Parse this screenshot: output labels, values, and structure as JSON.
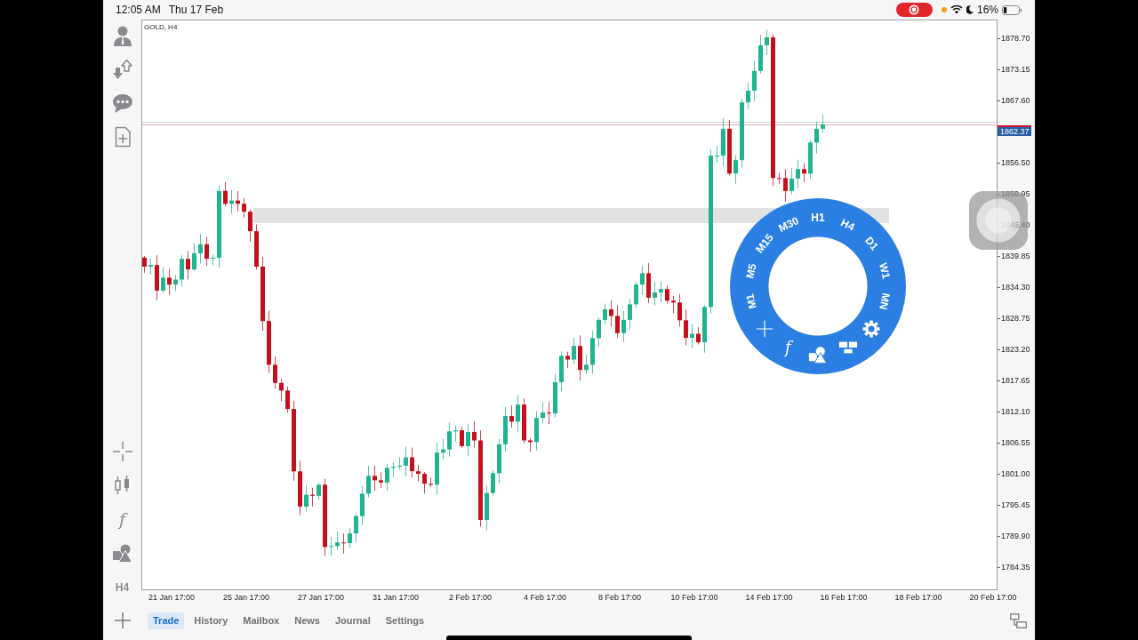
{
  "status_bar": {
    "time": "12:05 AM",
    "date": "Thu 17 Feb",
    "battery": "16%"
  },
  "left_toolbar": {
    "indicator_symbol": "f",
    "timeframe": "H4"
  },
  "chart": {
    "title": "GOLD, H4",
    "timeframe_dial": {
      "periods": [
        "M1",
        "M5",
        "M15",
        "M30",
        "H1",
        "H4",
        "D1",
        "W1",
        "MN"
      ],
      "indicator_symbol": "f"
    },
    "price_axis": [
      {
        "kind": "tick",
        "text": "1878.70"
      },
      {
        "kind": "tick",
        "text": "1873.15"
      },
      {
        "kind": "tick",
        "text": "1867.60"
      },
      {
        "kind": "current",
        "text": "1862.37"
      },
      {
        "kind": "tick",
        "text": "1856.50"
      },
      {
        "kind": "tick",
        "text": "1850.95"
      },
      {
        "kind": "tick",
        "text": "1845.40"
      },
      {
        "kind": "tick",
        "text": "1839.85"
      },
      {
        "kind": "tick",
        "text": "1834.30"
      },
      {
        "kind": "tick",
        "text": "1828.75"
      },
      {
        "kind": "tick",
        "text": "1823.20"
      },
      {
        "kind": "tick",
        "text": "1817.65"
      },
      {
        "kind": "tick",
        "text": "1812.10"
      },
      {
        "kind": "tick",
        "text": "1806.55"
      },
      {
        "kind": "tick",
        "text": "1801.00"
      },
      {
        "kind": "tick",
        "text": "1795.45"
      },
      {
        "kind": "tick",
        "text": "1789.90"
      },
      {
        "kind": "tick",
        "text": "1784.35"
      }
    ],
    "time_axis": [
      "21 Jan 17:00",
      "25 Jan 17:00",
      "27 Jan 17:00",
      "31 Jan 17:00",
      "2 Feb 17:00",
      "4 Feb 17:00",
      "8 Feb 17:00",
      "10 Feb 17:00",
      "14 Feb 17:00",
      "16 Feb 17:00",
      "18 Feb 17:00",
      "20 Feb 17:00"
    ]
  },
  "tabs": [
    {
      "label": "Trade",
      "selected": true
    },
    {
      "label": "History",
      "selected": false
    },
    {
      "label": "Mailbox",
      "selected": false
    },
    {
      "label": "News",
      "selected": false
    },
    {
      "label": "Journal",
      "selected": false
    },
    {
      "label": "Settings",
      "selected": false
    }
  ]
}
